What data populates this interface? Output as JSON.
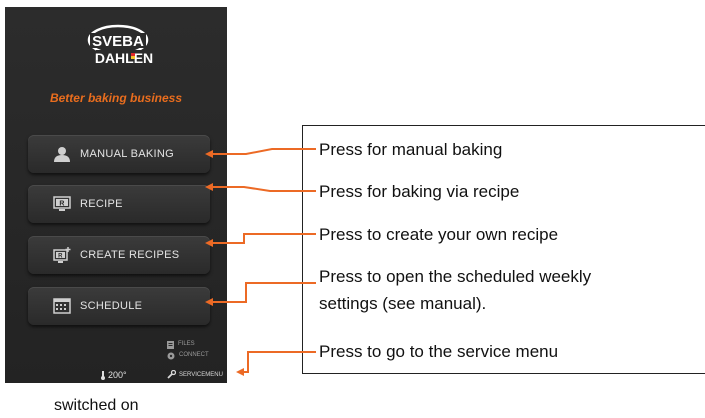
{
  "device": {
    "brand_line1": "SVEBA",
    "brand_line2": "DAHLEN",
    "tagline": "Better baking business",
    "buttons": [
      {
        "label": "MANUAL BAKING",
        "icon": "person-icon"
      },
      {
        "label": "RECIPE",
        "icon": "recipe-icon"
      },
      {
        "label": "CREATE RECIPES",
        "icon": "create-recipe-icon"
      },
      {
        "label": "SCHEDULE",
        "icon": "calendar-icon"
      }
    ],
    "small_links": [
      {
        "label": "FILES",
        "icon": "files-icon"
      },
      {
        "label": "CONNECT",
        "icon": "connect-icon"
      }
    ],
    "service_label": "SERVICEMENU",
    "temperature": "200°"
  },
  "callouts": [
    "Press for manual baking",
    "Press for baking via recipe",
    "Press to create your own recipe",
    "Press to open the scheduled weekly",
    "settings (see manual).",
    "Press to go to the service menu"
  ],
  "caption": "switched on",
  "colors": {
    "accent": "#e96d1e",
    "panel": "#2a2a2a",
    "arrow": "#ec6a25"
  }
}
